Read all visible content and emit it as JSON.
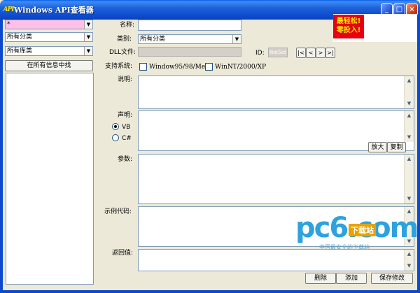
{
  "window": {
    "icon_text": "API",
    "title": "Windows API查看器",
    "minimize": "_",
    "maximize": "□",
    "close": "×"
  },
  "left_panel": {
    "filter_value": "*",
    "category_value": "所有分类",
    "library_value": "所有库类",
    "search_all_button": "在所有信息中找"
  },
  "form": {
    "name_label": "名称:",
    "category_label": "类别:",
    "category_value": "所有分类",
    "dll_label": "DLL文件:",
    "id_label": "ID:",
    "id_placeholder": "NotSet",
    "nav_first": "|<",
    "nav_prev": "<",
    "nav_next": ">",
    "nav_last": ">|",
    "support_label": "支持系统:",
    "os_option_1": "Window95/98/Me",
    "os_option_2": "WinNT/2000/XP",
    "description_label": "说明:",
    "declaration_label": "声明:",
    "lang_vb": "VB",
    "lang_cs": "C#",
    "zoom_button": "放大",
    "copy_button": "复制",
    "params_label": "参数:",
    "example_label": "示例代码:",
    "return_label": "返回值:"
  },
  "footer": {
    "delete_button": "删除",
    "add_button": "添加",
    "save_button": "保存修改"
  },
  "ad": {
    "line1": "最轻松!",
    "line2": "零投入!"
  },
  "watermark": {
    "logo": "pc6.com",
    "badge": "下载站",
    "tagline": "中国最安全的下载站"
  },
  "colors": {
    "titlebar": "#0c4bd0",
    "window_bg": "#ece9d8",
    "filter_bg": "#ffc0e8",
    "ad_bg": "#e60012",
    "watermark": "#2ea2dd"
  },
  "icons": {
    "combo_arrow": "chevron-down-icon",
    "scroll_up": "chevron-up-icon",
    "scroll_down": "chevron-down-icon"
  }
}
